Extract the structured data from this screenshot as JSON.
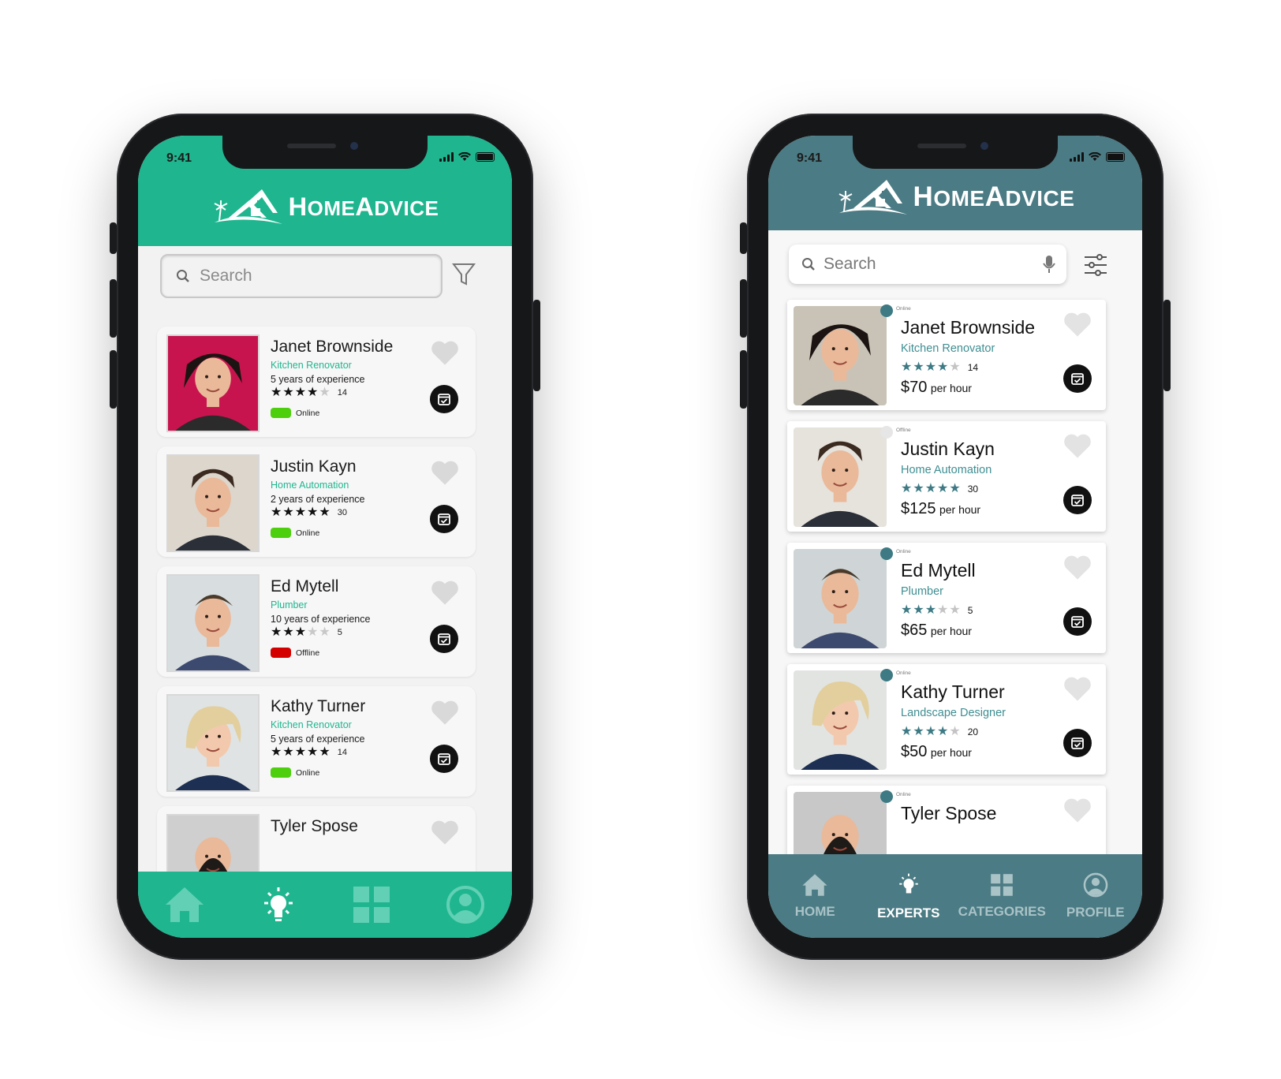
{
  "status": {
    "time": "9:41"
  },
  "brand": {
    "name": "HomeAdvice",
    "first_letter_h": "H",
    "rest_h": "OME",
    "first_letter_a": "A",
    "rest_a": "DVICE"
  },
  "colors": {
    "teal_green": "#1fb68f",
    "slate_teal": "#4b7b84",
    "online_green": "#4ecf0e",
    "offline_red": "#d40000"
  },
  "left_phone": {
    "search": {
      "placeholder": "Search"
    },
    "experts": [
      {
        "name": "Janet Brownside",
        "role": "Kitchen Renovator",
        "experience": "5 years of experience",
        "rating": 4,
        "reviews": "14",
        "status": "Online"
      },
      {
        "name": "Justin Kayn",
        "role": "Home Automation",
        "experience": "2 years of experience",
        "rating": 5,
        "reviews": "30",
        "status": "Online"
      },
      {
        "name": "Ed Mytell",
        "role": "Plumber",
        "experience": "10 years of experience",
        "rating": 3,
        "reviews": "5",
        "status": "Offline"
      },
      {
        "name": "Kathy Turner",
        "role": "Kitchen Renovator",
        "experience": "5 years of experience",
        "rating": 5,
        "reviews": "14",
        "status": "Online"
      },
      {
        "name": "Tyler Spose"
      }
    ],
    "nav": [
      "home-icon",
      "experts-icon",
      "categories-icon",
      "profile-icon"
    ]
  },
  "right_phone": {
    "search": {
      "placeholder": "Search"
    },
    "experts": [
      {
        "name": "Janet Brownside",
        "role": "Kitchen Renovator",
        "rating": 4,
        "reviews": "14",
        "price": "$70",
        "per": "per hour",
        "status": "Online"
      },
      {
        "name": "Justin Kayn",
        "role": "Home Automation",
        "rating": 5,
        "reviews": "30",
        "price": "$125",
        "per": "per hour",
        "status": "Offline"
      },
      {
        "name": "Ed Mytell",
        "role": "Plumber",
        "rating": 3,
        "reviews": "5",
        "price": "$65",
        "per": "per hour",
        "status": "Online"
      },
      {
        "name": "Kathy Turner",
        "role": "Landscape Designer",
        "rating": 4,
        "reviews": "20",
        "price": "$50",
        "per": "per hour",
        "status": "Online"
      },
      {
        "name": "Tyler Spose",
        "status": "Online"
      }
    ],
    "nav": [
      {
        "label": "HOME",
        "icon": "home-icon",
        "active": false
      },
      {
        "label": "EXPERTS",
        "icon": "experts-icon",
        "active": true
      },
      {
        "label": "CATEGORIES",
        "icon": "categories-icon",
        "active": false
      },
      {
        "label": "PROFILE",
        "icon": "profile-icon",
        "active": false
      }
    ]
  }
}
